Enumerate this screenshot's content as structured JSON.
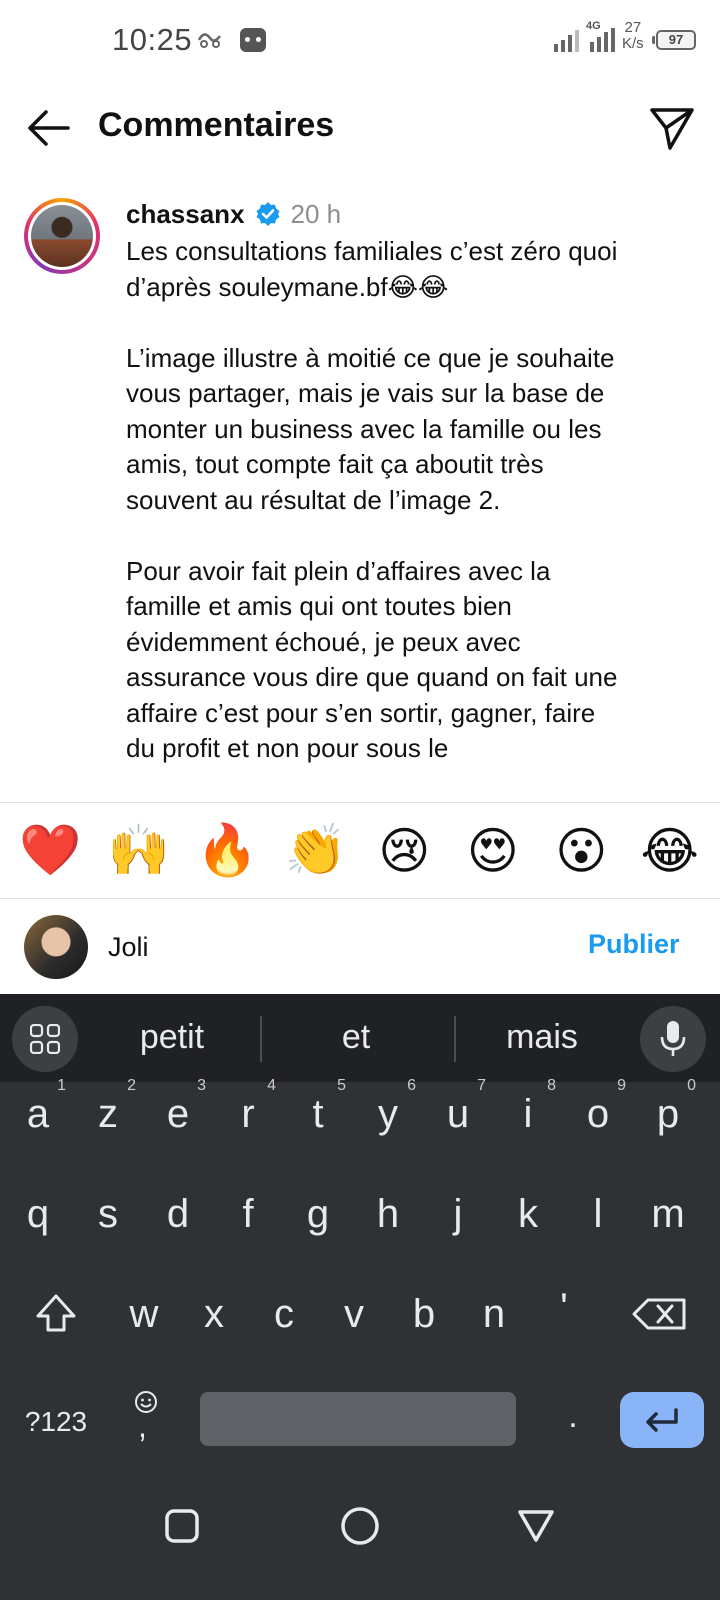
{
  "status_bar": {
    "time": "10:25",
    "network": "4G",
    "speed_value": "27",
    "speed_unit": "K/s",
    "battery": "97"
  },
  "header": {
    "title": "Commentaires"
  },
  "comment": {
    "username": "chassanx",
    "verified": true,
    "time": "20 h",
    "text": "Les consultations familiales c’est zéro quoi d’après souleymane.bf😂😂\n\nL’image illustre à moitié ce que je souhaite vous partager, mais je vais sur la base de monter un business avec la famille ou les amis, tout compte fait ça aboutit très souvent au résultat de l’image 2.\n\nPour avoir fait plein d’affaires avec la famille et amis qui ont toutes bien évidemment échoué, je peux avec assurance vous dire que quand on fait une affaire c’est pour s’en sortir, gagner, faire du profit et non pour sous le"
  },
  "emoji_bar": {
    "emojis": [
      "❤️",
      "🙌",
      "🔥",
      "👏",
      "😢",
      "😍",
      "😮",
      "😂"
    ]
  },
  "composer": {
    "value": "Joli",
    "publish_label": "Publier"
  },
  "keyboard": {
    "suggestions": [
      "petit",
      "et",
      "mais"
    ],
    "row1": [
      {
        "key": "a",
        "hint": "1"
      },
      {
        "key": "z",
        "hint": "2"
      },
      {
        "key": "e",
        "hint": "3"
      },
      {
        "key": "r",
        "hint": "4"
      },
      {
        "key": "t",
        "hint": "5"
      },
      {
        "key": "y",
        "hint": "6"
      },
      {
        "key": "u",
        "hint": "7"
      },
      {
        "key": "i",
        "hint": "8"
      },
      {
        "key": "o",
        "hint": "9"
      },
      {
        "key": "p",
        "hint": "0"
      }
    ],
    "row2": [
      "q",
      "s",
      "d",
      "f",
      "g",
      "h",
      "j",
      "k",
      "l",
      "m"
    ],
    "row3": [
      "w",
      "x",
      "c",
      "v",
      "b",
      "n",
      "'"
    ],
    "symbols_label": "?123",
    "emoji_comma": ",",
    "period": "."
  },
  "colors": {
    "publish_blue": "#1a9bf0",
    "keyboard_bg": "#2f3134",
    "enter_key": "#8ab4f8"
  }
}
